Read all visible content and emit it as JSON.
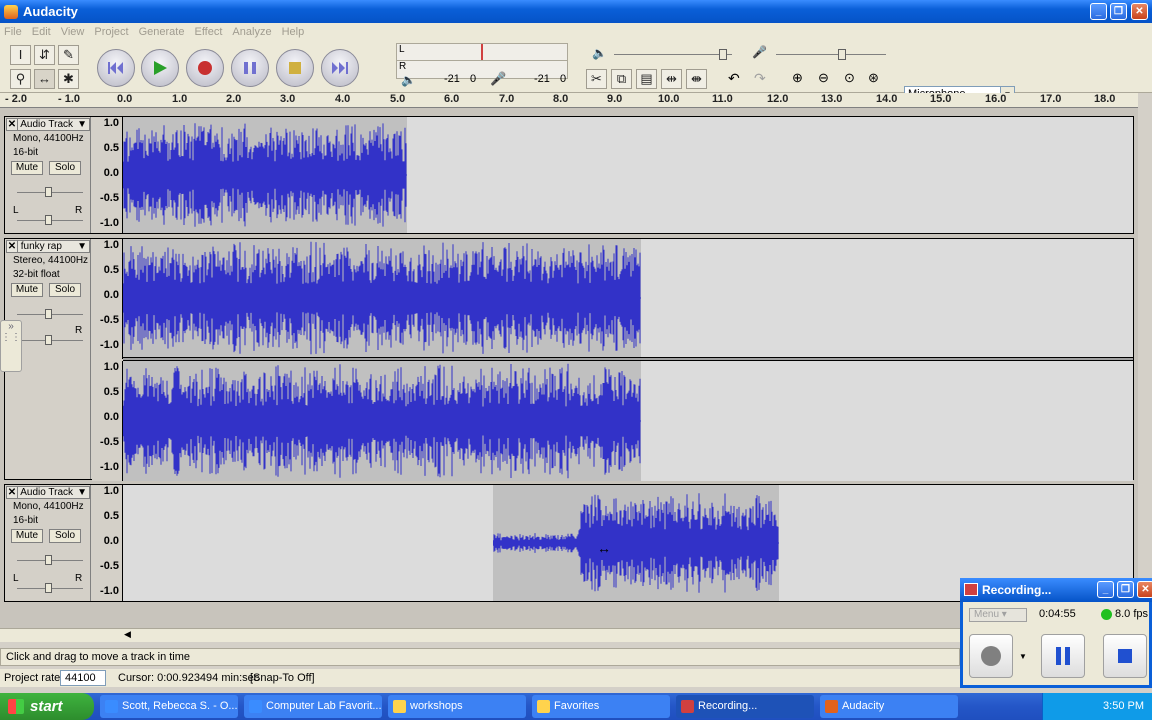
{
  "window": {
    "title": "Audacity"
  },
  "menu": [
    "File",
    "Edit",
    "View",
    "Project",
    "Generate",
    "Effect",
    "Analyze",
    "Help"
  ],
  "meters": {
    "left_label": "L",
    "right_label": "R",
    "db1": "-21",
    "zero1": "0",
    "db2": "-21",
    "zero2": "0"
  },
  "input_select": {
    "value": "Microphone"
  },
  "ruler": [
    "- 2.0",
    "- 1.0",
    "0.0",
    "1.0",
    "2.0",
    "3.0",
    "4.0",
    "5.0",
    "6.0",
    "7.0",
    "8.0",
    "9.0",
    "10.0",
    "11.0",
    "12.0",
    "13.0",
    "14.0",
    "15.0",
    "16.0",
    "17.0",
    "18.0"
  ],
  "tracks": [
    {
      "name": "Audio Track",
      "format": "Mono, 44100Hz",
      "bits": "16-bit",
      "mute": "Mute",
      "solo": "Solo",
      "L": "L",
      "R": "R",
      "scale": [
        "1.0",
        "0.5",
        "0.0",
        "-0.5",
        "-1.0"
      ]
    },
    {
      "name": "funky rap",
      "format": "Stereo, 44100Hz",
      "bits": "32-bit float",
      "mute": "Mute",
      "solo": "Solo",
      "L": "L",
      "R": "R",
      "scale": [
        "1.0",
        "0.5",
        "0.0",
        "-0.5",
        "-1.0"
      ],
      "scale2": [
        "1.0",
        "0.5",
        "0.0",
        "-0.5",
        "-1.0"
      ]
    },
    {
      "name": "Audio Track",
      "format": "Mono, 44100Hz",
      "bits": "16-bit",
      "mute": "Mute",
      "solo": "Solo",
      "L": "L",
      "R": "R",
      "scale": [
        "1.0",
        "0.5",
        "0.0",
        "-0.5",
        "-1.0"
      ]
    }
  ],
  "status": {
    "message": "Click and drag to move a track in time",
    "rate_label": "Project rate:",
    "rate_value": "44100",
    "cursor": "Cursor: 0:00.923494 min:sec",
    "snap": "[Snap-To Off]"
  },
  "recorder": {
    "title": "Recording...",
    "menu": "Menu",
    "time": "0:04:55",
    "fps": "8.0 fps"
  },
  "taskbar": {
    "start": "start",
    "items": [
      "Scott, Rebecca S. - O...",
      "Computer Lab Favorit...",
      "workshops",
      "Favorites",
      "Recording...",
      "Audacity"
    ],
    "clock": "3:50 PM"
  },
  "colors": {
    "wave": "#3232c8",
    "clip": "#c0c0c0",
    "bg": "#dcdcdc"
  }
}
